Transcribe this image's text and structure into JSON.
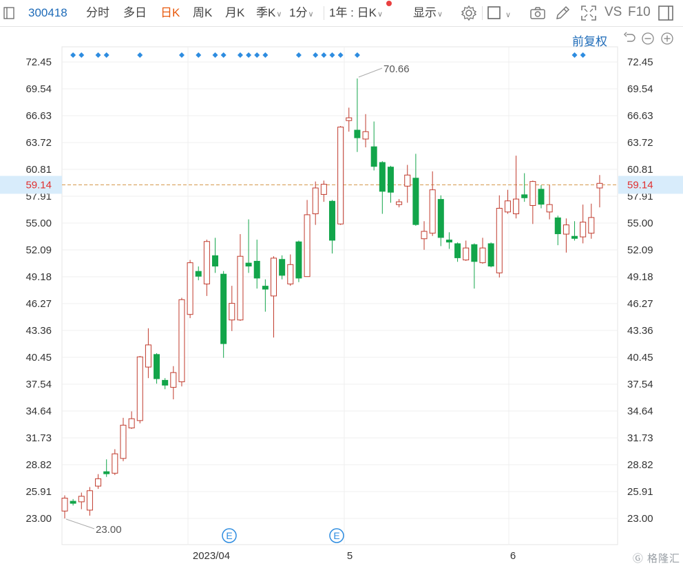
{
  "toolbar": {
    "code": "300418",
    "tabs": [
      {
        "label": "分时",
        "active": false
      },
      {
        "label": "多日",
        "active": false
      },
      {
        "label": "日K",
        "active": true
      },
      {
        "label": "周K",
        "active": false
      },
      {
        "label": "月K",
        "active": false
      }
    ],
    "season_k": "季K",
    "minute": "1分",
    "range": "1年 : 日K",
    "display": "显示",
    "vs": "VS",
    "f10": "F10",
    "icons": [
      "square-icon",
      "gear-icon",
      "rectangle-icon",
      "camera-icon",
      "pen-icon",
      "fullscreen-icon",
      "panel-icon"
    ],
    "accent": "#e8590c",
    "link": "#1e6bb8"
  },
  "adjust_label": "前复权",
  "right_controls": [
    "undo-icon",
    "zoom-out-icon",
    "zoom-in-icon"
  ],
  "watermark": "格隆汇",
  "chart_data": {
    "type": "candlestick",
    "y_ticks": [
      "72.45",
      "69.54",
      "66.63",
      "63.72",
      "60.81",
      "57.91",
      "55.00",
      "52.09",
      "49.18",
      "46.27",
      "43.36",
      "40.45",
      "37.54",
      "34.64",
      "31.73",
      "28.82",
      "25.91",
      "23.00"
    ],
    "ylim": [
      23.0,
      72.45
    ],
    "x_labels": [
      "2023/04",
      "5",
      "6"
    ],
    "current_price": "59.14",
    "max_label": "70.66",
    "min_label": "23.00",
    "event_marker": "E",
    "up_color": "#c0392b",
    "down_color": "#12a54a",
    "dot_color": "#2d8ce0",
    "dots": [
      1,
      2,
      4,
      5,
      9,
      14,
      16,
      18,
      19,
      21,
      22,
      23,
      24,
      28,
      30,
      31,
      32,
      33,
      35,
      61,
      62
    ],
    "events": [
      19,
      32
    ],
    "candles": [
      {
        "o": 23.8,
        "c": 25.2,
        "h": 25.5,
        "l": 23.0
      },
      {
        "o": 24.9,
        "c": 24.6,
        "h": 25.1,
        "l": 24.4
      },
      {
        "o": 24.8,
        "c": 25.4,
        "h": 25.8,
        "l": 24.0
      },
      {
        "o": 23.9,
        "c": 26.0,
        "h": 26.4,
        "l": 23.3
      },
      {
        "o": 26.5,
        "c": 27.3,
        "h": 27.8,
        "l": 26.2
      },
      {
        "o": 28.1,
        "c": 27.8,
        "h": 29.4,
        "l": 27.5
      },
      {
        "o": 27.9,
        "c": 30.0,
        "h": 30.5,
        "l": 27.7
      },
      {
        "o": 29.5,
        "c": 33.1,
        "h": 33.9,
        "l": 29.2
      },
      {
        "o": 32.8,
        "c": 33.8,
        "h": 34.6,
        "l": 32.7
      },
      {
        "o": 33.6,
        "c": 40.5,
        "h": 40.6,
        "l": 33.3
      },
      {
        "o": 39.4,
        "c": 41.8,
        "h": 43.6,
        "l": 38.2
      },
      {
        "o": 40.8,
        "c": 38.1,
        "h": 40.9,
        "l": 37.6
      },
      {
        "o": 38.0,
        "c": 37.4,
        "h": 38.2,
        "l": 37.0
      },
      {
        "o": 37.2,
        "c": 38.8,
        "h": 39.5,
        "l": 35.9
      },
      {
        "o": 37.8,
        "c": 46.7,
        "h": 46.9,
        "l": 37.3
      },
      {
        "o": 45.1,
        "c": 50.7,
        "h": 51.0,
        "l": 44.7
      },
      {
        "o": 49.8,
        "c": 49.2,
        "h": 50.3,
        "l": 48.8
      },
      {
        "o": 48.4,
        "c": 53.0,
        "h": 53.2,
        "l": 47.1
      },
      {
        "o": 51.5,
        "c": 50.3,
        "h": 53.4,
        "l": 49.6
      },
      {
        "o": 49.5,
        "c": 41.9,
        "h": 49.8,
        "l": 40.4
      },
      {
        "o": 44.5,
        "c": 46.3,
        "h": 48.2,
        "l": 43.3
      },
      {
        "o": 44.5,
        "c": 51.4,
        "h": 53.8,
        "l": 44.4
      },
      {
        "o": 50.7,
        "c": 50.3,
        "h": 55.4,
        "l": 49.6
      },
      {
        "o": 50.9,
        "c": 49.0,
        "h": 53.2,
        "l": 47.9
      },
      {
        "o": 48.2,
        "c": 47.8,
        "h": 48.9,
        "l": 45.4
      },
      {
        "o": 47.1,
        "c": 51.2,
        "h": 51.4,
        "l": 42.6
      },
      {
        "o": 51.1,
        "c": 49.3,
        "h": 51.5,
        "l": 48.9
      },
      {
        "o": 48.4,
        "c": 50.5,
        "h": 51.6,
        "l": 48.2
      },
      {
        "o": 53.0,
        "c": 49.0,
        "h": 53.1,
        "l": 48.6
      },
      {
        "o": 49.2,
        "c": 55.9,
        "h": 57.5,
        "l": 49.2
      },
      {
        "o": 56.0,
        "c": 58.8,
        "h": 59.5,
        "l": 54.8
      },
      {
        "o": 58.1,
        "c": 59.2,
        "h": 59.6,
        "l": 57.3
      },
      {
        "o": 57.4,
        "c": 53.1,
        "h": 57.5,
        "l": 51.7
      },
      {
        "o": 54.9,
        "c": 65.4,
        "h": 65.5,
        "l": 54.8
      },
      {
        "o": 66.1,
        "c": 66.4,
        "h": 67.5,
        "l": 64.9
      },
      {
        "o": 65.1,
        "c": 64.2,
        "h": 70.66,
        "l": 62.7
      },
      {
        "o": 64.1,
        "c": 64.9,
        "h": 66.8,
        "l": 63.2
      },
      {
        "o": 63.3,
        "c": 61.1,
        "h": 66.0,
        "l": 60.7
      },
      {
        "o": 61.6,
        "c": 58.4,
        "h": 61.7,
        "l": 56.0
      },
      {
        "o": 61.1,
        "c": 58.3,
        "h": 61.2,
        "l": 57.2
      },
      {
        "o": 57.0,
        "c": 57.3,
        "h": 57.6,
        "l": 56.7
      },
      {
        "o": 59.0,
        "c": 60.2,
        "h": 61.3,
        "l": 57.2
      },
      {
        "o": 59.9,
        "c": 54.8,
        "h": 62.5,
        "l": 54.7
      },
      {
        "o": 53.3,
        "c": 54.1,
        "h": 55.2,
        "l": 52.1
      },
      {
        "o": 53.9,
        "c": 58.6,
        "h": 60.6,
        "l": 53.6
      },
      {
        "o": 57.6,
        "c": 53.4,
        "h": 58.0,
        "l": 52.5
      },
      {
        "o": 53.2,
        "c": 52.9,
        "h": 54.0,
        "l": 52.2
      },
      {
        "o": 52.8,
        "c": 51.2,
        "h": 52.9,
        "l": 50.8
      },
      {
        "o": 51.0,
        "c": 52.3,
        "h": 53.1,
        "l": 50.9
      },
      {
        "o": 52.7,
        "c": 50.8,
        "h": 52.8,
        "l": 47.9
      },
      {
        "o": 50.7,
        "c": 52.3,
        "h": 53.4,
        "l": 50.6
      },
      {
        "o": 52.8,
        "c": 50.3,
        "h": 52.9,
        "l": 50.2
      },
      {
        "o": 49.6,
        "c": 56.6,
        "h": 58.0,
        "l": 49.1
      },
      {
        "o": 56.2,
        "c": 57.4,
        "h": 58.6,
        "l": 56.0
      },
      {
        "o": 56.0,
        "c": 57.6,
        "h": 62.3,
        "l": 55.5
      },
      {
        "o": 58.1,
        "c": 57.7,
        "h": 60.4,
        "l": 57.3
      },
      {
        "o": 56.9,
        "c": 59.5,
        "h": 59.6,
        "l": 54.9
      },
      {
        "o": 58.7,
        "c": 57.0,
        "h": 59.1,
        "l": 56.6
      },
      {
        "o": 56.2,
        "c": 57.0,
        "h": 59.1,
        "l": 55.4
      },
      {
        "o": 55.6,
        "c": 53.8,
        "h": 55.8,
        "l": 52.6
      },
      {
        "o": 53.8,
        "c": 54.8,
        "h": 55.5,
        "l": 51.8
      },
      {
        "o": 53.6,
        "c": 53.3,
        "h": 55.2,
        "l": 53.1
      },
      {
        "o": 53.5,
        "c": 55.1,
        "h": 57.0,
        "l": 52.8
      },
      {
        "o": 53.9,
        "c": 55.6,
        "h": 57.1,
        "l": 53.3
      },
      {
        "o": 58.8,
        "c": 59.3,
        "h": 60.2,
        "l": 56.7
      }
    ]
  }
}
